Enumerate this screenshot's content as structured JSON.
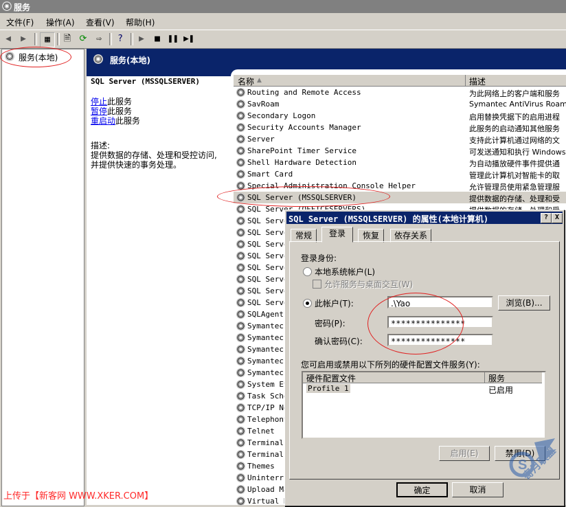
{
  "window": {
    "title": "服务"
  },
  "menu": [
    "文件(F)",
    "操作(A)",
    "查看(V)",
    "帮助(H)"
  ],
  "tree": {
    "root": "服务(本地)"
  },
  "panel": {
    "header": "服务(本地)"
  },
  "detail": {
    "service_name": "SQL Server (MSSQLSERVER)",
    "stop_link": "停止",
    "stop_suffix": "此服务",
    "pause_link": "暂停",
    "pause_suffix": "此服务",
    "restart_link": "重启动",
    "restart_suffix": "此服务",
    "desc_label": "描述:",
    "desc_text": "提供数据的存储、处理和受控访问,并提供快速的事务处理。"
  },
  "list": {
    "columns": [
      "名称",
      "描述"
    ],
    "rows": [
      {
        "name": "Routing and Remote Access",
        "desc": "为此网络上的客户端和服务"
      },
      {
        "name": "SavRoam",
        "desc": "Symantec AntiVirus Roami"
      },
      {
        "name": "Secondary Logon",
        "desc": "启用替换凭据下的启用进程"
      },
      {
        "name": "Security Accounts Manager",
        "desc": "此服务的启动通知其他服务"
      },
      {
        "name": "Server",
        "desc": "支持此计算机通过网络的文"
      },
      {
        "name": "SharePoint Timer Service",
        "desc": "可发送通知和执行 Windows"
      },
      {
        "name": "Shell Hardware Detection",
        "desc": "为自动播放硬件事件提供通"
      },
      {
        "name": "Smart Card",
        "desc": "管理此计算机对智能卡的取"
      },
      {
        "name": "Special Administration Console Helper",
        "desc": "允许管理员使用紧急管理服"
      },
      {
        "name": "SQL Server (MSSQLSERVER)",
        "desc": "提供数据的存储、处理和受"
      },
      {
        "name": "SQL Server (OFFICESERVERS)",
        "desc": "提供数据的存储、处理和受"
      },
      {
        "name": "SQL Server",
        "desc": ""
      },
      {
        "name": "SQL Server",
        "desc": ""
      },
      {
        "name": "SQL Server",
        "desc": ""
      },
      {
        "name": "SQL Server",
        "desc": ""
      },
      {
        "name": "SQL Server",
        "desc": ""
      },
      {
        "name": "SQL Server",
        "desc": ""
      },
      {
        "name": "SQL Server",
        "desc": ""
      },
      {
        "name": "SQL Server",
        "desc": ""
      },
      {
        "name": "SQLAgent$",
        "desc": ""
      },
      {
        "name": "Symantec",
        "desc": ""
      },
      {
        "name": "Symantec",
        "desc": ""
      },
      {
        "name": "Symantec",
        "desc": ""
      },
      {
        "name": "Symantec",
        "desc": ""
      },
      {
        "name": "Symantec",
        "desc": ""
      },
      {
        "name": "System Ev",
        "desc": ""
      },
      {
        "name": "Task Sche",
        "desc": ""
      },
      {
        "name": "TCP/IP Ne",
        "desc": ""
      },
      {
        "name": "Telephony",
        "desc": ""
      },
      {
        "name": "Telnet",
        "desc": ""
      },
      {
        "name": "Terminal",
        "desc": ""
      },
      {
        "name": "Terminal",
        "desc": ""
      },
      {
        "name": "Themes",
        "desc": ""
      },
      {
        "name": "Uninterru",
        "desc": ""
      },
      {
        "name": "Upload Ma",
        "desc": ""
      },
      {
        "name": "Virtual D",
        "desc": ""
      }
    ]
  },
  "dialog": {
    "title": "SQL Server (MSSQLSERVER) 的属性(本地计算机)",
    "help_btn": "?",
    "close_btn": "X",
    "tabs": [
      "常规",
      "登录",
      "恢复",
      "依存关系"
    ],
    "logon_as_label": "登录身份:",
    "local_system_label": "本地系统帐户(L)",
    "allow_desktop_label": "允许服务与桌面交互(W)",
    "this_account_label": "此帐户(T):",
    "account_value": ".\\Yao",
    "browse_btn": "浏览(B)...",
    "password_label": "密码(P):",
    "password_value": "***************",
    "confirm_label": "确认密码(C):",
    "confirm_value": "***************",
    "profiles_label": "您可启用或禁用以下所列的硬件配置文件服务(Y):",
    "profiles_columns": [
      "硬件配置文件",
      "服务"
    ],
    "profiles_rows": [
      {
        "profile": "Profile 1",
        "service": "已启用"
      }
    ],
    "enable_btn": "启用(E)",
    "disable_btn": "禁用(D)",
    "ok_btn": "确定",
    "cancel_btn": "取消"
  },
  "watermark": "上传于【新客网 WWW.XKER.COM】",
  "logo_text": "寄月联盟"
}
